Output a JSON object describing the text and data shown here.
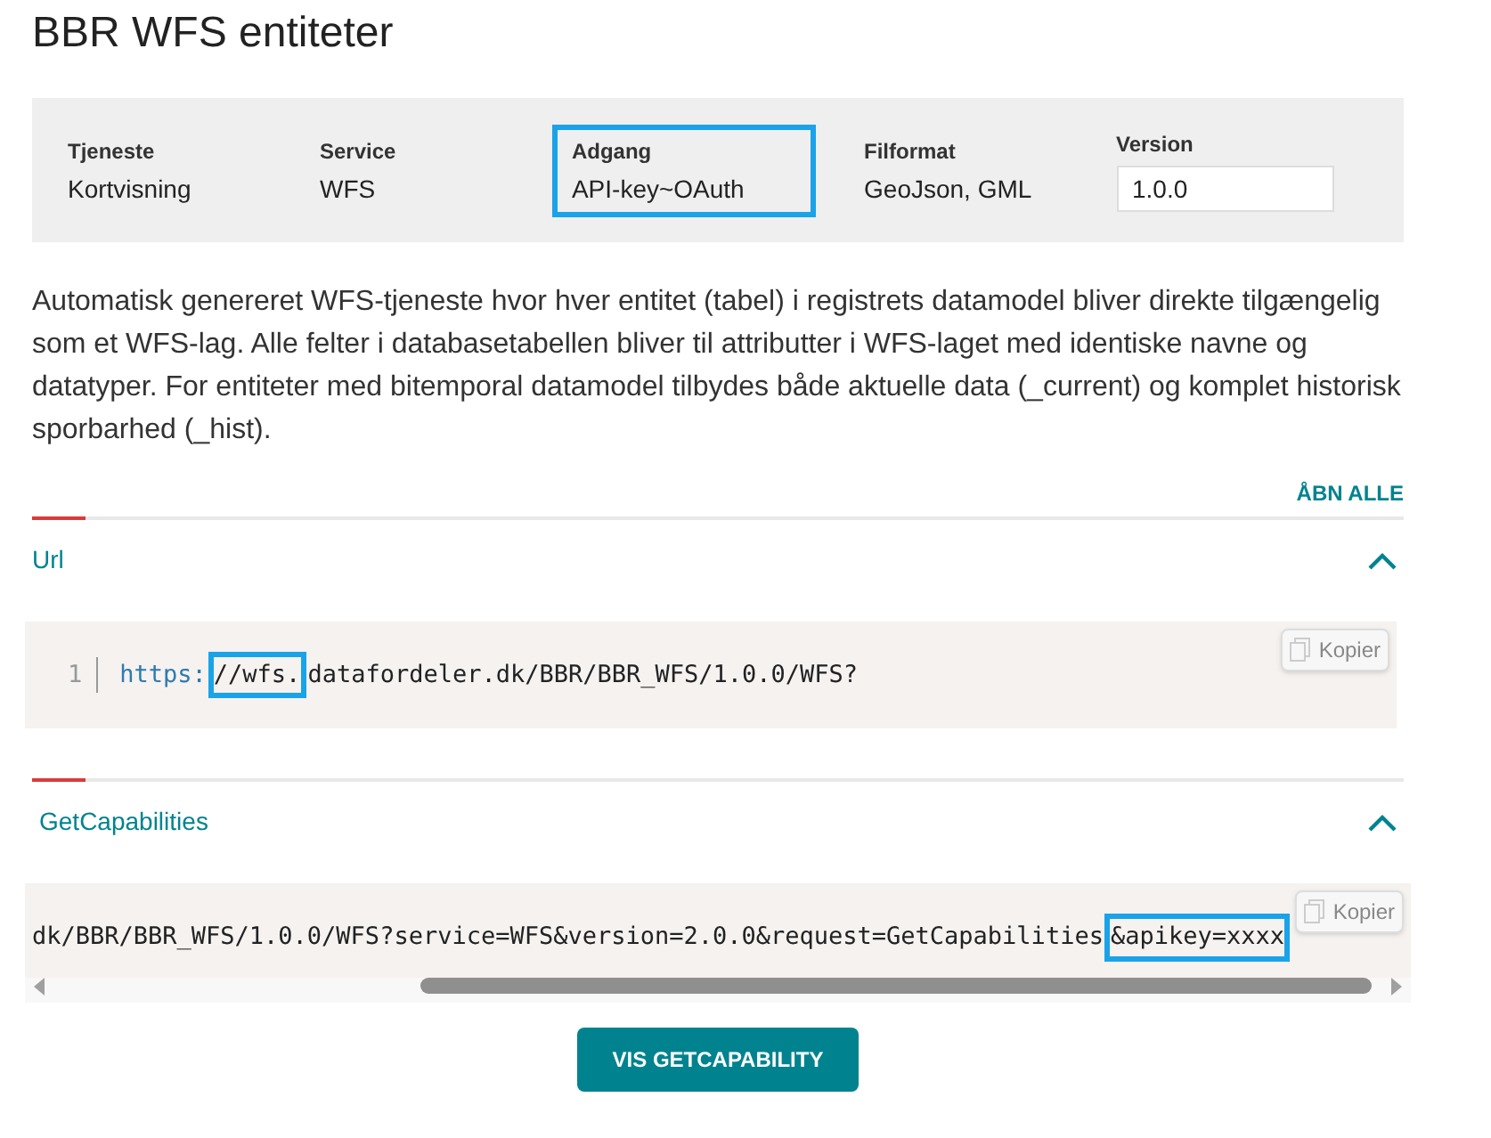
{
  "title": "BBR WFS entiteter",
  "meta": [
    {
      "label": "Tjeneste",
      "value": "Kortvisning",
      "kind": "text",
      "highlighted": false
    },
    {
      "label": "Service",
      "value": "WFS",
      "kind": "text",
      "highlighted": false
    },
    {
      "label": "Adgang",
      "value": "API-key~OAuth",
      "kind": "text",
      "highlighted": true
    },
    {
      "label": "Filformat",
      "value": "GeoJson, GML",
      "kind": "text",
      "highlighted": false
    },
    {
      "label": "Version",
      "value": "1.0.0",
      "kind": "select",
      "highlighted": false
    }
  ],
  "description": "Automatisk genereret WFS-tjeneste hvor hver entitet (tabel) i registrets datamodel bliver direkte tilgængelig som et WFS-lag. Alle felter i databasetabellen bliver til attributter i WFS-laget med identiske navne og datatyper. For entiteter med bitemporal datamodel tilbydes både aktuelle data (_current) og komplet historisk sporbarhed (_hist).",
  "expand_all": "ÅBN ALLE",
  "sections": [
    {
      "title": "Url",
      "expanded": true,
      "line_number": "1",
      "copy_label": "Kopier",
      "scrollbar": false,
      "segments": [
        {
          "text": "https:",
          "kind": "scheme",
          "highlighted": false
        },
        {
          "text": "//wfs.",
          "kind": "plain",
          "highlighted": true
        },
        {
          "text": "datafordeler.dk/BBR/BBR_WFS/1.0.0/WFS?",
          "kind": "plain",
          "highlighted": false
        }
      ]
    },
    {
      "title": "GetCapabilities",
      "expanded": true,
      "copy_label": "Kopier",
      "scrollbar": true,
      "segments": [
        {
          "text": "dk/BBR/BBR_WFS/1.0.0/WFS?service=WFS&version=2.0.0&request=GetCapabilities",
          "kind": "plain",
          "highlighted": false
        },
        {
          "text": "&apikey=xxxx",
          "kind": "plain",
          "highlighted": true
        }
      ]
    }
  ],
  "button": "VIS GETCAPABILITY"
}
